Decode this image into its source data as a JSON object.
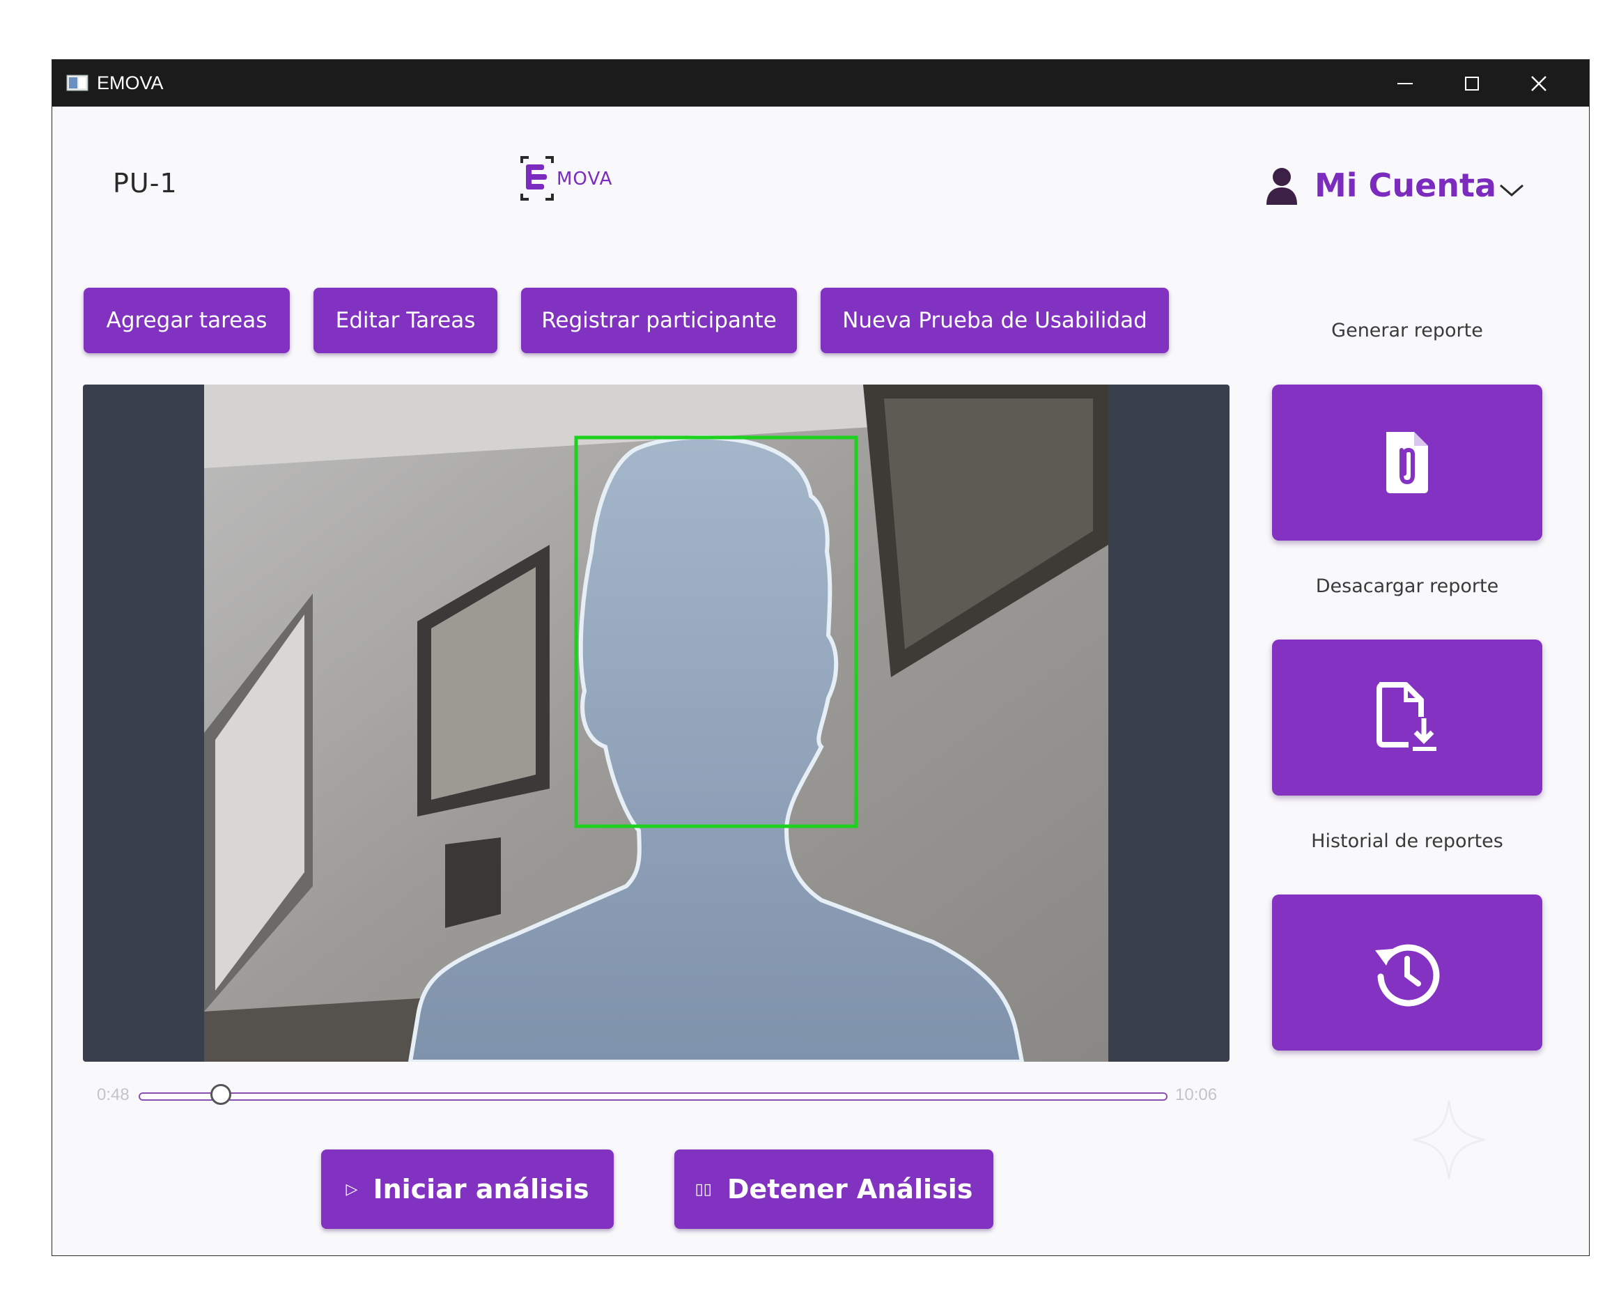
{
  "window": {
    "title": "EMOVA"
  },
  "header": {
    "project_id": "PU-1",
    "logo_text": "MOVA",
    "account_label": "Mi Cuenta"
  },
  "toolbar": {
    "add_tasks": "Agregar tareas",
    "edit_tasks": "Editar Tareas",
    "register_participant": "Registrar participante",
    "new_usability_test": "Nueva Prueba de Usabilidad"
  },
  "sidebar": {
    "generate_report_label": "Generar reporte",
    "download_report_label": "Desacargar reporte",
    "report_history_label": "Historial de reportes"
  },
  "player": {
    "current_time": "0:48",
    "total_time": "10:06",
    "progress_fraction": 0.08
  },
  "controls": {
    "start_analysis": "Iniciar análisis",
    "stop_analysis": "Detener Análisis"
  },
  "colors": {
    "accent": "#8132c0",
    "titlebar": "#1b1b1b",
    "face_box": "#1fd11f"
  },
  "icons": {
    "generate": "file-attachment-icon",
    "download": "file-download-icon",
    "history": "history-icon",
    "account": "user-icon"
  }
}
